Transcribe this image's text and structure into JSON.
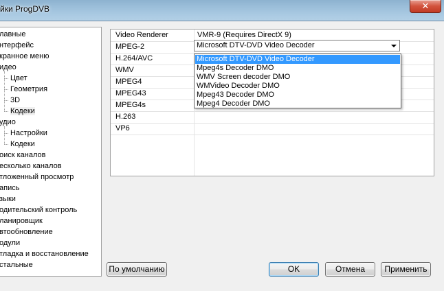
{
  "window": {
    "title": "йки ProgDVB",
    "close_glyph": "✕"
  },
  "tree": {
    "items": [
      {
        "label": "лавные",
        "level": 0
      },
      {
        "label": "нтерфейс",
        "level": 0
      },
      {
        "label": "кранное меню",
        "level": 0
      },
      {
        "label": "идео",
        "level": 0
      },
      {
        "label": "Цвет",
        "level": 1
      },
      {
        "label": "Геометрия",
        "level": 1
      },
      {
        "label": "3D",
        "level": 1
      },
      {
        "label": "Кодеки",
        "level": 1,
        "selected": true
      },
      {
        "label": "удио",
        "level": 0
      },
      {
        "label": "Настройки",
        "level": 1
      },
      {
        "label": "Кодеки",
        "level": 1
      },
      {
        "label": "оиск каналов",
        "level": 0
      },
      {
        "label": "есколько каналов",
        "level": 0
      },
      {
        "label": "тложенный просмотр",
        "level": 0
      },
      {
        "label": "апись",
        "level": 0
      },
      {
        "label": "зыки",
        "level": 0
      },
      {
        "label": "одительский контроль",
        "level": 0
      },
      {
        "label": "ланировщик",
        "level": 0
      },
      {
        "label": "втообновление",
        "level": 0
      },
      {
        "label": "одули",
        "level": 0
      },
      {
        "label": "тладка и восстановление",
        "level": 0
      },
      {
        "label": "стальные",
        "level": 0
      }
    ]
  },
  "grid": {
    "rows": [
      {
        "key": "Video Renderer",
        "value": "VMR-9 (Requires DirectX 9)"
      },
      {
        "key": "MPEG-2",
        "value": ""
      },
      {
        "key": "H.264/AVC",
        "value": ""
      },
      {
        "key": "WMV",
        "value": ""
      },
      {
        "key": "MPEG4",
        "value": ""
      },
      {
        "key": "MPEG43",
        "value": ""
      },
      {
        "key": "MPEG4s",
        "value": ""
      },
      {
        "key": "H.263",
        "value": ""
      },
      {
        "key": "VP6",
        "value": ""
      }
    ]
  },
  "combo": {
    "selected": "Microsoft DTV-DVD Video Decoder",
    "options": [
      "Microsoft DTV-DVD Video Decoder",
      "Mpeg4s Decoder DMO",
      "WMV Screen decoder DMO",
      "WMVideo Decoder DMO",
      "Mpeg43 Decoder DMO",
      "Mpeg4 Decoder DMO"
    ],
    "highlighted_index": 0
  },
  "buttons": {
    "defaults": "По умолчанию",
    "ok": "OK",
    "cancel": "Отмена",
    "apply": "Применить"
  },
  "colors": {
    "selection": "#3399ff",
    "titlebar": "#9cbfda",
    "close": "#c23b24"
  }
}
